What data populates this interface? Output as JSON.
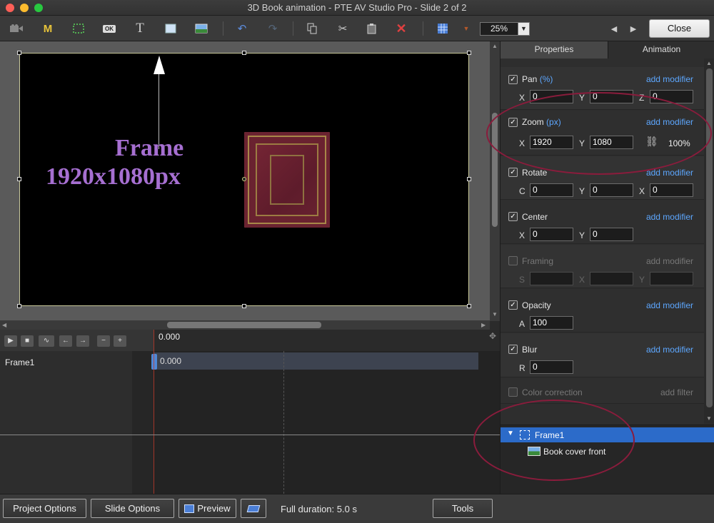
{
  "window": {
    "title": "3D Book animation - PTE AV Studio Pro - Slide 2 of 2"
  },
  "toolbar": {
    "tools": [
      {
        "name": "camera-icon",
        "glyph": "■"
      },
      {
        "name": "m-icon",
        "glyph": "M"
      },
      {
        "name": "frame-icon",
        "glyph": "⬚"
      },
      {
        "name": "button-icon",
        "glyph": "OK"
      },
      {
        "name": "text-icon",
        "glyph": "T"
      },
      {
        "name": "rectangle-icon",
        "glyph": "□"
      },
      {
        "name": "image-icon",
        "glyph": "▨"
      }
    ],
    "zoom_value": "25%",
    "close_label": "Close"
  },
  "canvas": {
    "frame_text_line1": "Frame",
    "frame_text_line2": "1920x1080px"
  },
  "timeline": {
    "ruler_time": "0.000",
    "track_label": "Frame1",
    "track_time": "0.000"
  },
  "panel": {
    "tabs": [
      "Properties",
      "Animation"
    ],
    "active_tab": "Animation",
    "add_modifier_label": "add modifier",
    "sections": {
      "pan": {
        "title": "Pan",
        "unit": "(%)",
        "checked": true,
        "fields": [
          {
            "label": "X",
            "value": "0"
          },
          {
            "label": "Y",
            "value": "0"
          },
          {
            "label": "Z",
            "value": "0"
          }
        ]
      },
      "zoom": {
        "title": "Zoom",
        "unit": "(px)",
        "checked": true,
        "fields": [
          {
            "label": "X",
            "value": "1920"
          },
          {
            "label": "Y",
            "value": "1080"
          }
        ],
        "percent": "100%"
      },
      "rotate": {
        "title": "Rotate",
        "checked": true,
        "fields": [
          {
            "label": "C",
            "value": "0"
          },
          {
            "label": "Y",
            "value": "0"
          },
          {
            "label": "X",
            "value": "0"
          }
        ]
      },
      "center": {
        "title": "Center",
        "checked": true,
        "fields": [
          {
            "label": "X",
            "value": "0"
          },
          {
            "label": "Y",
            "value": "0"
          }
        ]
      },
      "framing": {
        "title": "Framing",
        "checked": false,
        "fields": [
          {
            "label": "S",
            "value": ""
          },
          {
            "label": "X",
            "value": ""
          },
          {
            "label": "Y",
            "value": ""
          }
        ]
      },
      "opacity": {
        "title": "Opacity",
        "checked": true,
        "fields": [
          {
            "label": "A",
            "value": "100"
          }
        ]
      },
      "blur": {
        "title": "Blur",
        "checked": true,
        "fields": [
          {
            "label": "R",
            "value": "0"
          }
        ]
      },
      "color_correction": {
        "title": "Color correction",
        "checked": false,
        "add_label": "add filter"
      }
    }
  },
  "tree": {
    "items": [
      {
        "label": "Frame1",
        "selected": true
      },
      {
        "label": "Book cover front",
        "selected": false
      }
    ]
  },
  "bottom": {
    "project_options": "Project Options",
    "slide_options": "Slide Options",
    "preview": "Preview",
    "duration": "Full duration: 5.0 s",
    "tools": "Tools"
  },
  "colors": {
    "accent": "#5da7ff",
    "selection": "#2c6bc9",
    "annotation": "#8a1c3c",
    "frame_text": "#a66fd1"
  }
}
